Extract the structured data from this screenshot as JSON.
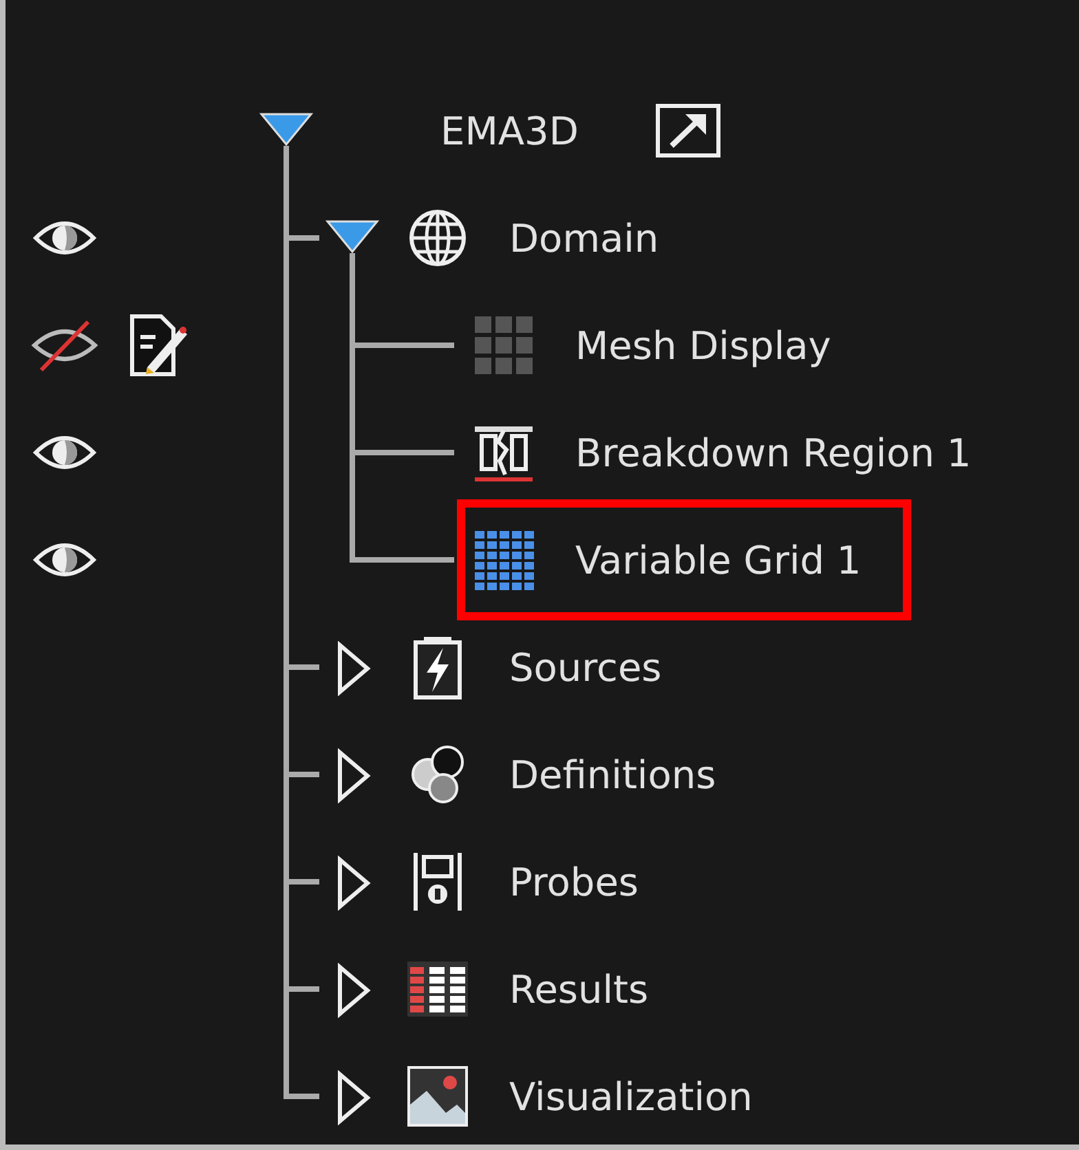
{
  "tree": {
    "label": "EMA3D",
    "expanded": true,
    "children": [
      {
        "label": "Domain",
        "kind": "domain",
        "expanded": true,
        "selected": false,
        "visible": true,
        "children": [
          {
            "label": "Mesh Display",
            "kind": "mesh",
            "selected": false,
            "visible": false,
            "editable": true
          },
          {
            "label": "Breakdown Region 1",
            "kind": "breakdown",
            "selected": false,
            "visible": true
          },
          {
            "label": "Variable Grid 1",
            "kind": "grid",
            "selected": true,
            "visible": true
          }
        ]
      },
      {
        "label": "Sources",
        "kind": "sources",
        "expanded": false,
        "selected": false
      },
      {
        "label": "Definitions",
        "kind": "definitions",
        "expanded": false,
        "selected": false
      },
      {
        "label": "Probes",
        "kind": "probes",
        "expanded": false,
        "selected": false
      },
      {
        "label": "Results",
        "kind": "results",
        "expanded": false,
        "selected": false
      },
      {
        "label": "Visualization",
        "kind": "visualization",
        "expanded": false,
        "selected": false
      }
    ]
  }
}
